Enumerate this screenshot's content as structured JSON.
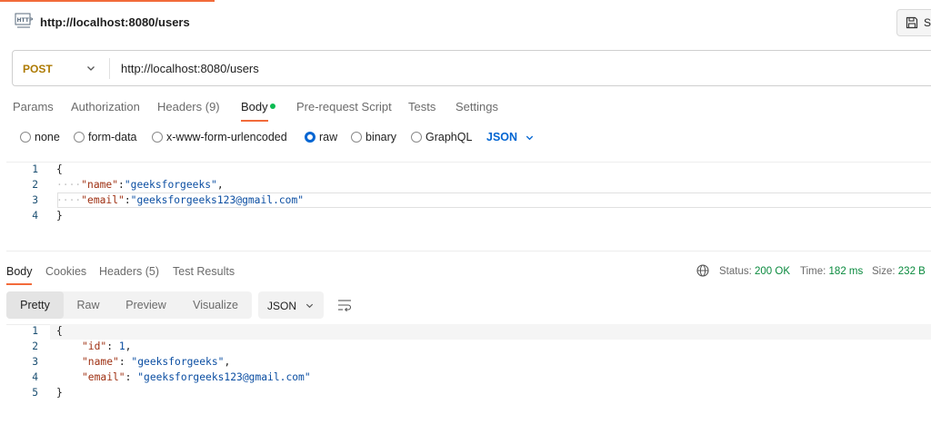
{
  "request": {
    "tab_title": "http://localhost:8080/users",
    "save_label": "S",
    "method": "POST",
    "url": "http://localhost:8080/users"
  },
  "request_tabs": [
    {
      "label": "Params"
    },
    {
      "label": "Authorization"
    },
    {
      "label": "Headers (9)"
    },
    {
      "label": "Body"
    },
    {
      "label": "Pre-request Script"
    },
    {
      "label": "Tests"
    },
    {
      "label": "Settings"
    }
  ],
  "body_types": [
    {
      "label": "none"
    },
    {
      "label": "form-data"
    },
    {
      "label": "x-www-form-urlencoded"
    },
    {
      "label": "raw"
    },
    {
      "label": "binary"
    },
    {
      "label": "GraphQL"
    }
  ],
  "raw_format": "JSON",
  "request_body": {
    "line_numbers": [
      "1",
      "2",
      "3",
      "4"
    ],
    "lines": [
      {
        "open": "{"
      },
      {
        "dots": "····",
        "key": "\"name\"",
        "colon": ":",
        "value": "\"geeksforgeeks\"",
        "trail": ","
      },
      {
        "dots": "····",
        "key": "\"email\"",
        "colon": ":",
        "value": "\"geeksforgeeks123@gmail.com\"",
        "trail": ""
      },
      {
        "close": "}"
      }
    ]
  },
  "response_tabs": [
    {
      "label": "Body"
    },
    {
      "label": "Cookies"
    },
    {
      "label": "Headers (5)"
    },
    {
      "label": "Test Results"
    }
  ],
  "response_status": {
    "status_label": "Status:",
    "status_value": "200 OK",
    "time_label": "Time:",
    "time_value": "182 ms",
    "size_label": "Size:",
    "size_value": "232 B"
  },
  "view_modes": [
    {
      "label": "Pretty"
    },
    {
      "label": "Raw"
    },
    {
      "label": "Preview"
    },
    {
      "label": "Visualize"
    }
  ],
  "response_format": "JSON",
  "response_body": {
    "line_numbers": [
      "1",
      "2",
      "3",
      "4",
      "5"
    ],
    "lines": [
      {
        "open": "{"
      },
      {
        "key": "\"id\"",
        "colon": ": ",
        "value": "1",
        "trail": ","
      },
      {
        "key": "\"name\"",
        "colon": ": ",
        "value": "\"geeksforgeeks\"",
        "trail": ","
      },
      {
        "key": "\"email\"",
        "colon": ": ",
        "value": "\"geeksforgeeks123@gmail.com\"",
        "trail": ""
      },
      {
        "close": "}"
      }
    ]
  },
  "colors": {
    "accent": "#f26b3a",
    "link_blue": "#0265d2",
    "method_post": "#ad7a03",
    "status_ok": "#0a8a3e"
  }
}
